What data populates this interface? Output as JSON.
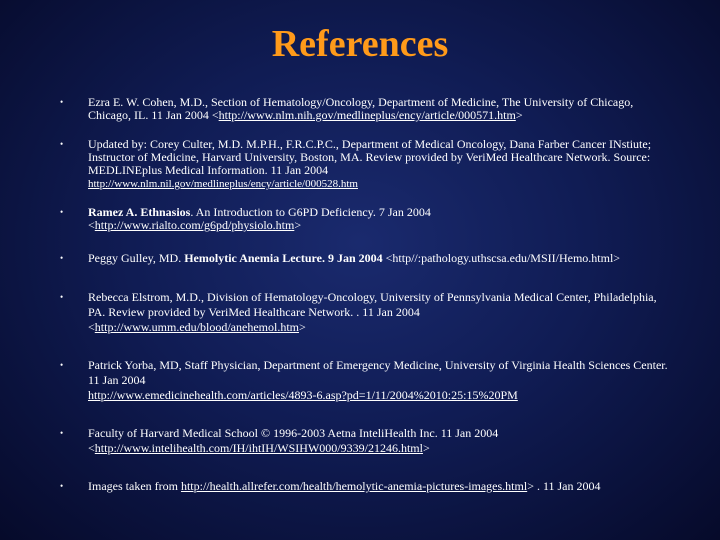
{
  "title": "References",
  "bullet": "•",
  "refs": {
    "r1": {
      "text": "Ezra E. W. Cohen, M.D., Section of Hematology/Oncology, Department of Medicine, The University of Chicago, Chicago, IL. 11 Jan 2004 <",
      "link": "http://www.nlm.nih.gov/medlineplus/ency/article/000571.htm",
      "after": ">"
    },
    "r2": {
      "text": "Updated by: Corey Culter, M.D. M.P.H., F.R.C.P.C., Department of Medical Oncology, Dana Farber Cancer INstiute; Instructor of Medicine, Harvard University, Boston, MA. Review provided by VeriMed Healthcare Network. Source: MEDLINEplus Medical Information. 11 Jan 2004",
      "link": "http://www.nlm.nil.gov/medlineplus/ency/article/000528.htm"
    },
    "r3": {
      "bold": "Ramez A. Ethnasios",
      "text": ". An Introduction to G6PD Deficiency. 7 Jan 2004",
      "before_link": "<",
      "link": "http://www.rialto.com/g6pd/physiolo.htm",
      "after": ">"
    },
    "r4": {
      "text": "Peggy Gulley, MD. ",
      "bold": "Hemolytic Anemia Lecture. 9 Jan 2004",
      "after": " <http//:pathology.uthscsa.edu/MSII/Hemo.html>"
    },
    "r5": {
      "text": "Rebecca Elstrom, M.D., Division of Hematology-Oncology, University of Pennsylvania Medical Center, Philadelphia, PA. Review provided by VeriMed Healthcare Network. . 11 Jan 2004",
      "before_link": "<",
      "link": "http://www.umm.edu/blood/anehemol.htm",
      "after": ">"
    },
    "r6": {
      "text": "Patrick Yorba, MD, Staff Physician, Department of Emergency Medicine, University of Virginia Health Sciences Center. 11 Jan 2004",
      "link": "http://www.emedicinehealth.com/articles/4893-6.asp?pd=1/11/2004%2010:25:15%20PM"
    },
    "r7": {
      "text": "Faculty of Harvard Medical School © 1996-2003 Aetna InteliHealth Inc. 11 Jan 2004",
      "before_link": "<",
      "link": "http://www.intelihealth.com/IH/ihtIH/WSIHW000/9339/21246.html",
      "after": ">"
    },
    "r8": {
      "text": "Images taken from ",
      "link": "http://health.allrefer.com/health/hemolytic-anemia-pictures-images.html",
      "after": "> . 11 Jan 2004"
    }
  }
}
